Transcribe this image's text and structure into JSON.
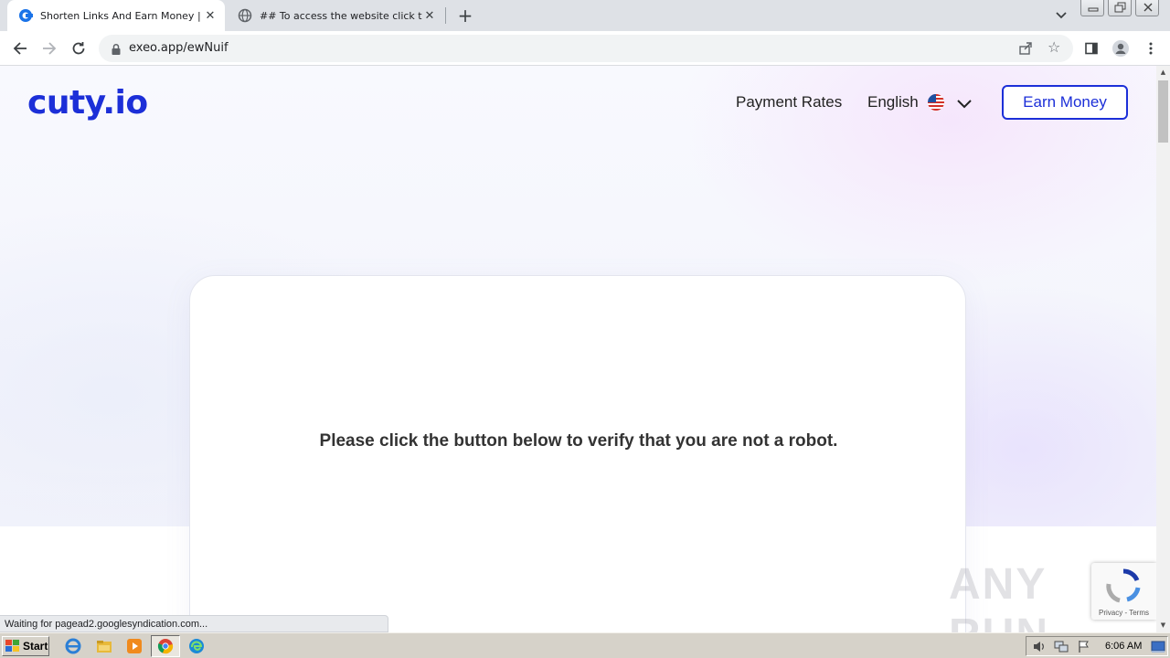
{
  "browser": {
    "tabs": [
      {
        "title": "Shorten Links And Earn Money | cut",
        "active": true
      },
      {
        "title": "## To access the website click the \"A",
        "active": false
      }
    ],
    "new_tab_label": "+",
    "close_glyph": "✕",
    "url": "exeo.app/ewNuif"
  },
  "site": {
    "logo_text": "cuty.io",
    "nav": {
      "payment_rates": "Payment Rates",
      "language": "English"
    },
    "earn_button": "Earn Money",
    "card_message": "Please click the button below to verify that you are not a robot.",
    "brand_color": "#1c2fd8"
  },
  "overlay": {
    "watermark": "ANY RUN",
    "recaptcha_text": "Privacy - Terms"
  },
  "status_bar": "Waiting for pagead2.googlesyndication.com...",
  "taskbar": {
    "start_label": "Start",
    "clock": "6:06 AM"
  }
}
